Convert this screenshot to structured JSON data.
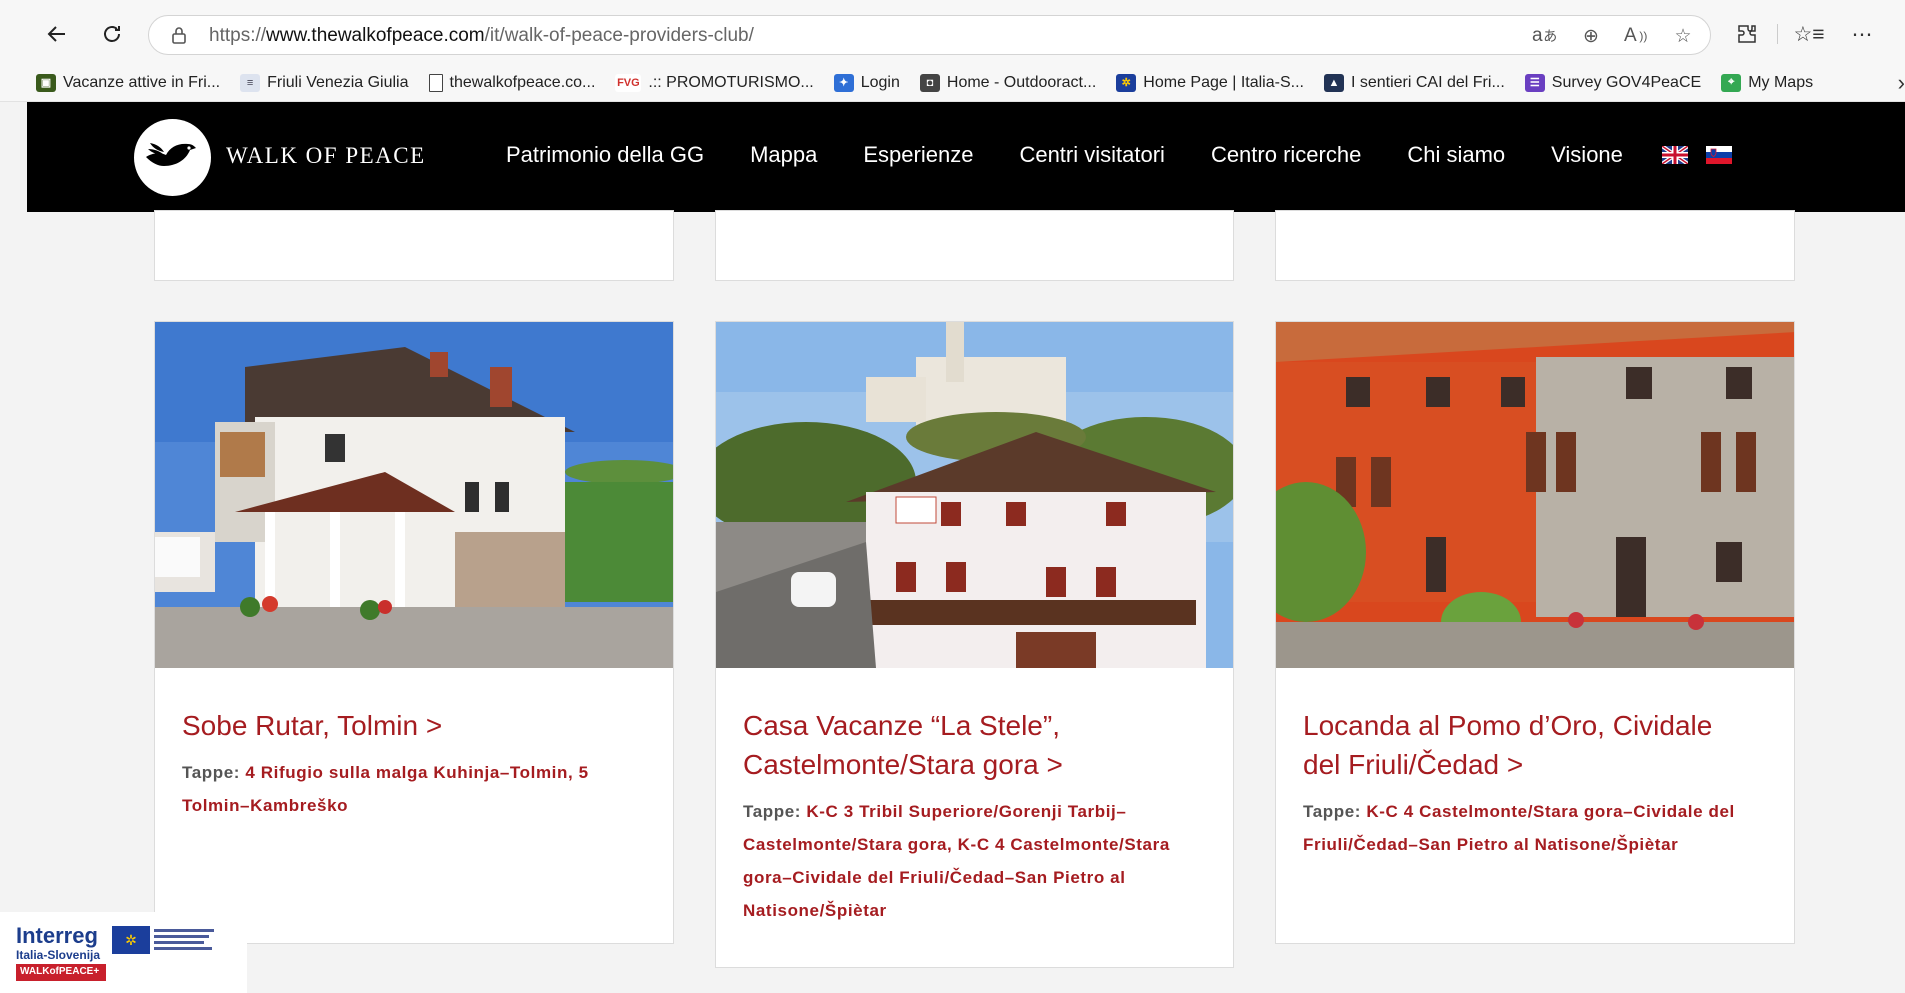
{
  "browser": {
    "url_prefix": "https://",
    "url_domain": "www.thewalkofpeace.com",
    "url_path": "/it/walk-of-peace-providers-club/",
    "bookmarks": [
      {
        "label": "Vacanze attive in Fri...",
        "icon": "green-square",
        "color": "#3a5a1c"
      },
      {
        "label": "Friuli Venezia Giulia",
        "icon": "fvg-icon",
        "color": "#6b7fb0"
      },
      {
        "label": "thewalkofpeace.co...",
        "icon": "page-icon",
        "color": "#ffffff"
      },
      {
        "label": ".:: PROMOTURISMO...",
        "icon": "fvg-red-icon",
        "color": "#d0312d"
      },
      {
        "label": "Login",
        "icon": "login-icon",
        "color": "#2f6fd6"
      },
      {
        "label": "Home - Outdooract...",
        "icon": "outdoor-icon",
        "color": "#444444"
      },
      {
        "label": "Home Page | Italia-S...",
        "icon": "eu-flag-icon",
        "color": "#1b3e9c"
      },
      {
        "label": "I sentieri CAI del Fri...",
        "icon": "cai-icon",
        "color": "#223355"
      },
      {
        "label": "Survey GOV4PeaCE",
        "icon": "survey-icon",
        "color": "#6a3fc1"
      },
      {
        "label": "My Maps",
        "icon": "maps-icon",
        "color": "#34a853"
      }
    ]
  },
  "site": {
    "logo_text": "WALK OF PEACE",
    "menu": [
      "Patrimonio della GG",
      "Mappa",
      "Esperienze",
      "Centri visitatori",
      "Centro ricerche",
      "Chi siamo",
      "Visione"
    ],
    "accent": "#a51c20"
  },
  "cards": [
    {
      "title_lines": [
        "Sobe Rutar, Tolmin >"
      ],
      "tappe_label": "Tappe: ",
      "tappe_lines": [
        "4 Rifugio sulla malga Kuhinja–Tolmin, 5",
        "Tolmin–Kambreško"
      ]
    },
    {
      "title_lines": [
        "Casa Vacanze “La Stele”,",
        "Castelmonte/Stara gora >"
      ],
      "tappe_label": "Tappe: ",
      "tappe_lines": [
        "K-C 3 Tribil Superiore/Gorenji Tarbij–",
        "Castelmonte/Stara gora, K-C 4 Castelmonte/Stara",
        "gora–Cividale del Friuli/Čedad–San Pietro al",
        "Natisone/Špiètar"
      ]
    },
    {
      "title_lines": [
        "Locanda al Pomo d’Oro, Cividale",
        "del Friuli/Čedad >"
      ],
      "tappe_label": "Tappe: ",
      "tappe_lines": [
        "K-C 4 Castelmonte/Stara gora–Cividale del",
        "Friuli/Čedad–San Pietro al Natisone/Špiètar"
      ]
    }
  ],
  "interreg": {
    "name": "Interreg",
    "region": "Italia-Slovenija",
    "project": "WALKofPEACE+"
  }
}
